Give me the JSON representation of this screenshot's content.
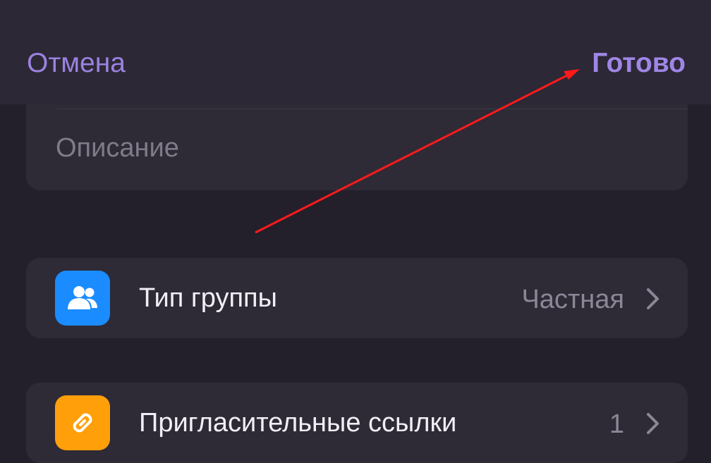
{
  "navbar": {
    "cancel_label": "Отмена",
    "done_label": "Готово"
  },
  "description": {
    "placeholder": "Описание"
  },
  "group_type": {
    "label": "Тип группы",
    "value": "Частная",
    "icon": "people-icon",
    "icon_color": "#1a8cff"
  },
  "invite_links": {
    "label": "Пригласительные ссылки",
    "count": "1",
    "icon": "link-icon",
    "icon_color": "#ff9f0a"
  },
  "annotation": {
    "color": "#ff1a1a"
  },
  "colors": {
    "accent": "#9b82e0",
    "background": "#231f2b",
    "card": "#2e2a36"
  }
}
